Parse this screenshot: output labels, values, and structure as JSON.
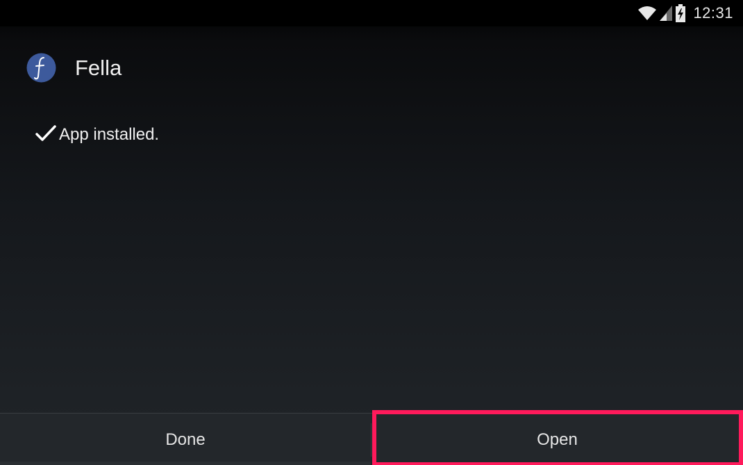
{
  "status_bar": {
    "time": "12:31",
    "icons": [
      "wifi-icon",
      "signal-icon",
      "battery-charging-icon"
    ]
  },
  "app": {
    "name": "Fella",
    "icon": "fella-app-icon",
    "icon_letter": "f",
    "icon_color": "#3d5a9c"
  },
  "message": {
    "icon": "check-icon",
    "text": "App installed."
  },
  "buttons": {
    "done_label": "Done",
    "open_label": "Open"
  },
  "highlight": {
    "target": "open-button",
    "color": "#ff1a5b"
  }
}
